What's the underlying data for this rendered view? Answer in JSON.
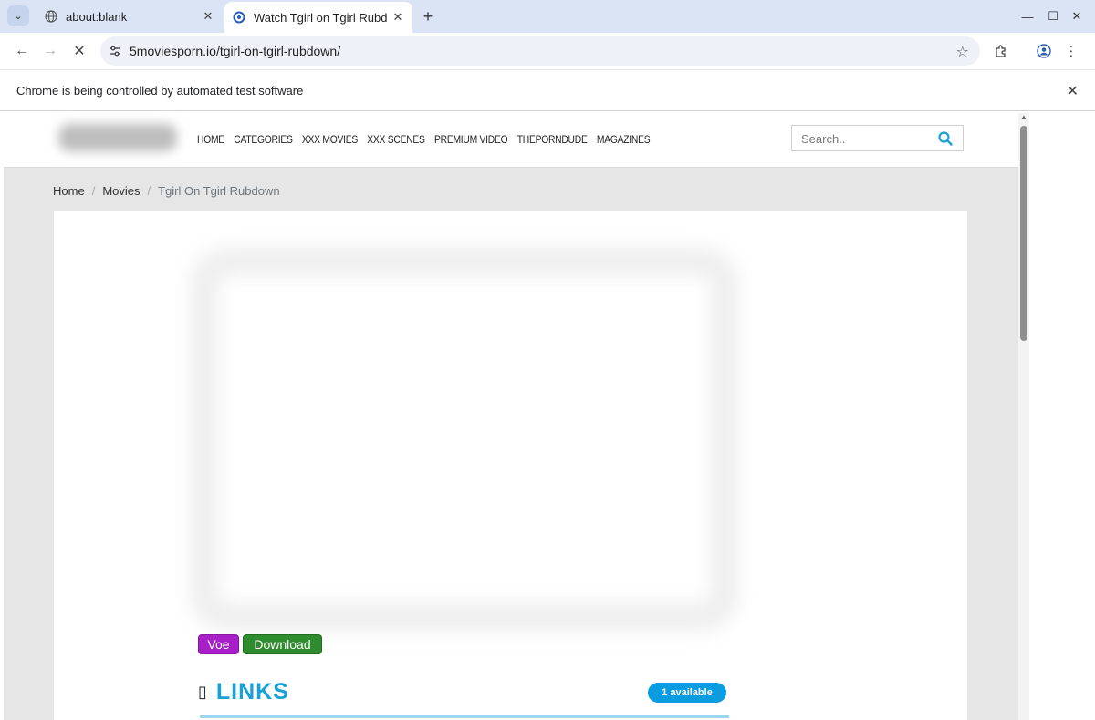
{
  "browser": {
    "tabs": [
      {
        "title": "about:blank",
        "active": false
      },
      {
        "title": "Watch Tgirl on Tgirl Rubd",
        "active": true
      }
    ],
    "url": "5moviesporn.io/tgirl-on-tgirl-rubdown/",
    "infobar_message": "Chrome is being controlled by automated test software"
  },
  "site": {
    "nav": [
      "HOME",
      "CATEGORIES",
      "XXX MOVIES",
      "XXX SCENES",
      "PREMIUM VIDEO",
      "THEPORNDUDE",
      "MAGAZINES"
    ],
    "search_placeholder": "Search.."
  },
  "breadcrumb": {
    "home": "Home",
    "movies": "Movies",
    "current": "Tgirl On Tgirl Rubdown"
  },
  "player": {
    "buttons": {
      "voe": "Voe",
      "download": "Download"
    }
  },
  "links": {
    "icon_glyph": "▯",
    "title": "LINKS",
    "badge": "1 available"
  },
  "colors": {
    "voe": "#a61fc7",
    "download": "#2e8b2e",
    "links_title": "#1aa0d6",
    "badge": "#0b9ce0"
  }
}
